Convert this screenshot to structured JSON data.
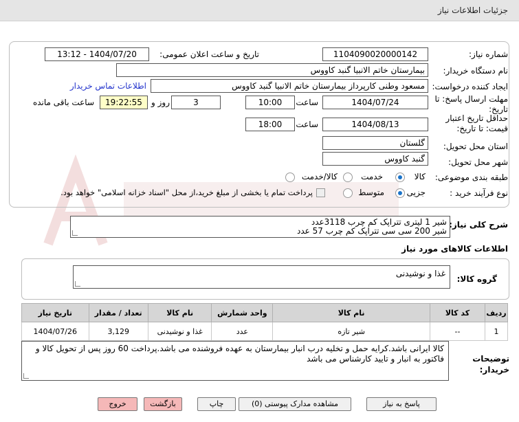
{
  "window": {
    "title": "جزئیات اطلاعات نیاز"
  },
  "form": {
    "need_number": {
      "label": "شماره نیاز:",
      "value": "1104090020000142"
    },
    "announce_datetime": {
      "label": "تاریخ و ساعت اعلان عمومی:",
      "value": "1404/07/20 - 13:12"
    },
    "buyer_org": {
      "label": "نام دستگاه خریدار:",
      "value": "بیمارستان خاتم الانبیا گنبد کاووس"
    },
    "requester": {
      "label": "ایجاد کننده درخواست:",
      "value": "مسعود وطنی کارپرداز بیمارستان خاتم الانبیا گنبد کاووس",
      "contact_link": "اطلاعات تماس خریدار"
    },
    "reply_deadline": {
      "label": "مهلت ارسال پاسخ: تا تاریخ:",
      "date": "1404/07/24",
      "time_label": "ساعت",
      "time": "10:00",
      "days": "3",
      "days_label": "روز و",
      "remaining": "19:22:55",
      "remaining_label": "ساعت باقی مانده"
    },
    "price_validity": {
      "label": "حداقل تاریخ اعتبار قیمت: تا تاریخ:",
      "date": "1404/08/13",
      "time_label": "ساعت",
      "time": "18:00"
    },
    "delivery_province": {
      "label": "استان محل تحویل:",
      "value": "گلستان"
    },
    "delivery_city": {
      "label": "شهر محل تحویل:",
      "value": "گنبد کاووس"
    },
    "category": {
      "label": "طبقه بندی موضوعی:",
      "options": [
        "کالا",
        "خدمت",
        "کالا/خدمت"
      ],
      "selected": "کالا"
    },
    "process_type": {
      "label": "نوع فرآیند خرید :",
      "options": [
        "جزیی",
        "متوسط"
      ],
      "selected": "جزیی",
      "payment_checkbox": "پرداخت تمام یا بخشی از مبلغ خرید،از محل \"اسناد خزانه اسلامی\" خواهد بود."
    }
  },
  "summary": {
    "label": "شرح کلی نیاز:",
    "line1": "شیر 1 لیتری تتراپک کم چرب 3118عدد",
    "line2": "شیر 200 سی سی تتراپک کم چرب 57 عدد"
  },
  "goods_section": {
    "title": "اطلاعات کالاهای مورد نیاز",
    "group_label": "گروه کالا:",
    "group_value": "غذا و نوشیدنی"
  },
  "table": {
    "headers": [
      "ردیف",
      "کد کالا",
      "نام کالا",
      "واحد شمارش",
      "نام کالا",
      "تعداد / مقدار",
      "تاریخ نیاز"
    ],
    "rows": [
      [
        "1",
        "--",
        "شیر تازه",
        "عدد",
        "غذا و نوشیدنی",
        "3,129",
        "1404/07/26"
      ]
    ]
  },
  "buyer_notes": {
    "label": "توضیحات خریدار:",
    "text": "کالا ایرانی باشد.کرایه حمل و تخلیه درب انبار بیمارستان به عهده فروشنده می باشد.پرداخت 60 روز پس از تحویل کالا و فاکتور به انبار و تایید کارشناس می باشد"
  },
  "buttons": {
    "reply": "پاسخ به نیاز",
    "attachments": "مشاهده مدارک پیوستی (0)",
    "print": "چاپ",
    "back": "بازگشت",
    "exit": "خروج"
  },
  "colors": {
    "title_bg": "#e5e5e5",
    "table_header": "#d6d6d6",
    "remaining_bg": "#ffffc8",
    "exit_button": "#f5b8b8",
    "link": "#2233cc"
  }
}
